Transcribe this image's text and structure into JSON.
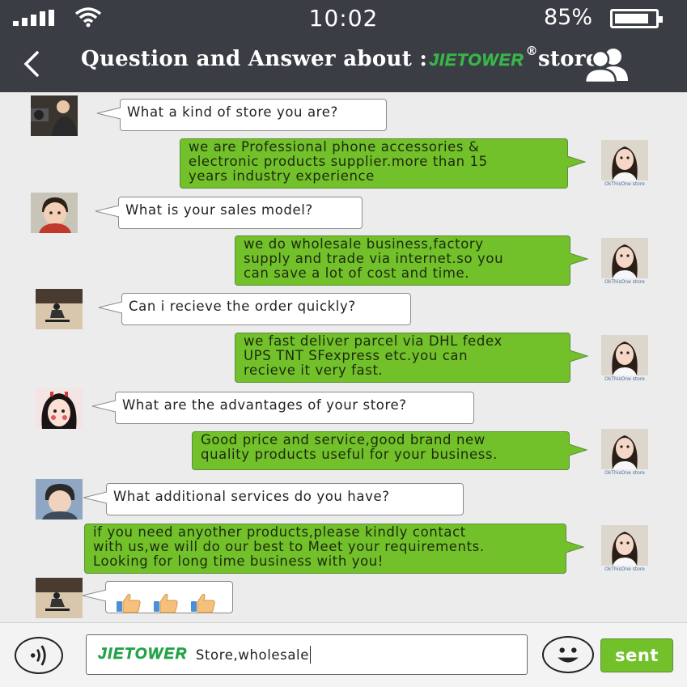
{
  "status_bar": {
    "time": "10:02",
    "battery": "85%",
    "battery_level": 0.85
  },
  "header": {
    "title_prefix": "Question and Answer about :",
    "brand": "JIETOWER",
    "registered": "®",
    "title_suffix": "store"
  },
  "agent_caption": "OkThisOne store",
  "messages": [
    {
      "role": "customer",
      "avatar": "avatar-man-camera",
      "text": "What a kind of store you are?"
    },
    {
      "role": "agent",
      "text": "we are Professional phone accessories &\nelectronic products supplier.more than 15\nyears industry experience"
    },
    {
      "role": "customer",
      "avatar": "avatar-child",
      "text": "What is your sales model?"
    },
    {
      "role": "agent",
      "text": "we do wholesale business,factory\nsupply and trade via internet.so you\ncan save a lot of cost and time."
    },
    {
      "role": "customer",
      "avatar": "avatar-skateboard",
      "text": "Can i recieve the order quickly?"
    },
    {
      "role": "agent",
      "text": "we fast deliver parcel via DHL fedex\nUPS TNT SFexpress etc.you can\nrecieve it very fast."
    },
    {
      "role": "customer",
      "avatar": "avatar-girl",
      "text": "What are the advantages of your store?"
    },
    {
      "role": "agent",
      "text": "Good price and service,good brand new\nquality products useful for your business."
    },
    {
      "role": "customer",
      "avatar": "avatar-boy",
      "text": "What additional services do you have?"
    },
    {
      "role": "agent",
      "text": "if you need anyother products,please kindly contact\nwith us,we will do our best to Meet your requirements.\nLooking for long time business with you!"
    },
    {
      "role": "customer",
      "avatar": "avatar-skateboard",
      "text": "👍👍👍"
    }
  ],
  "input": {
    "brand": "JIETOWER",
    "value": "Store,wholesale"
  },
  "send_label": "sent",
  "colors": {
    "header_bg": "#3a3d44",
    "agent_bubble": "#72c12a",
    "brand_green": "#39b54a"
  }
}
